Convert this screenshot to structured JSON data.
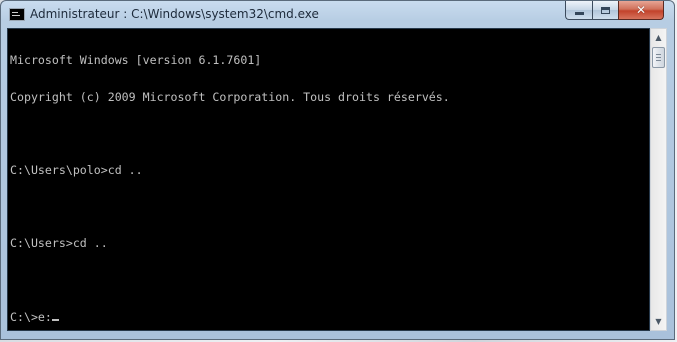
{
  "window": {
    "title": "Administrateur : C:\\Windows\\system32\\cmd.exe",
    "app_icon": "console-icon",
    "caption_buttons": {
      "minimize_icon": "minimize-icon",
      "maximize_icon": "maximize-icon",
      "close_glyph": "✕"
    }
  },
  "console": {
    "lines": [
      "Microsoft Windows [version 6.1.7601]",
      "Copyright (c) 2009 Microsoft Corporation. Tous droits réservés.",
      "",
      "C:\\Users\\polo>cd ..",
      "",
      "C:\\Users>cd ..",
      "",
      "C:\\>e:"
    ],
    "text_color": "#c0c0c0",
    "background": "#000000"
  },
  "scrollbar": {
    "up_arrow": "▲",
    "down_arrow": "▼"
  }
}
